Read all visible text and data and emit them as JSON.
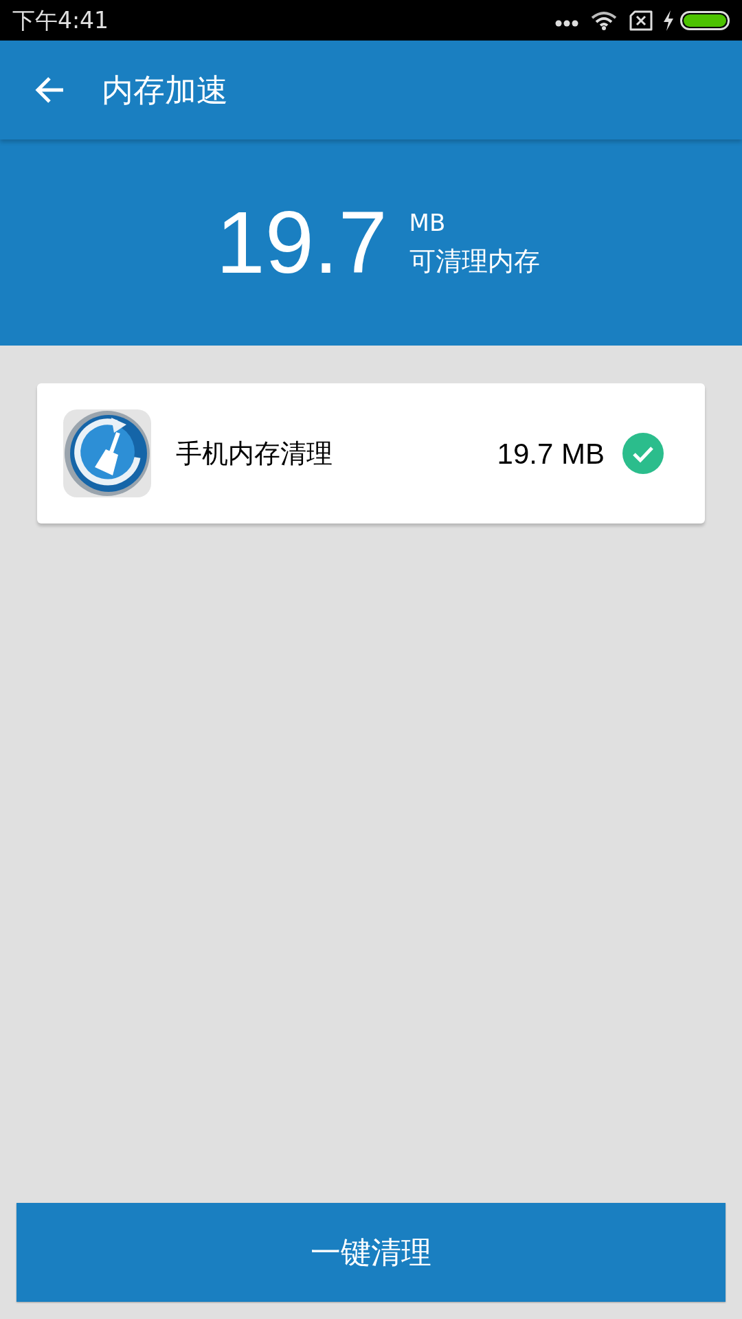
{
  "status_bar": {
    "time": "下午4:41"
  },
  "app_bar": {
    "title": "内存加速"
  },
  "summary": {
    "amount": "19.7",
    "unit": "MB",
    "caption": "可清理内存"
  },
  "items": [
    {
      "name": "手机内存清理",
      "size": "19.7 MB",
      "checked": true
    }
  ],
  "action_button": {
    "label": "一键清理"
  }
}
